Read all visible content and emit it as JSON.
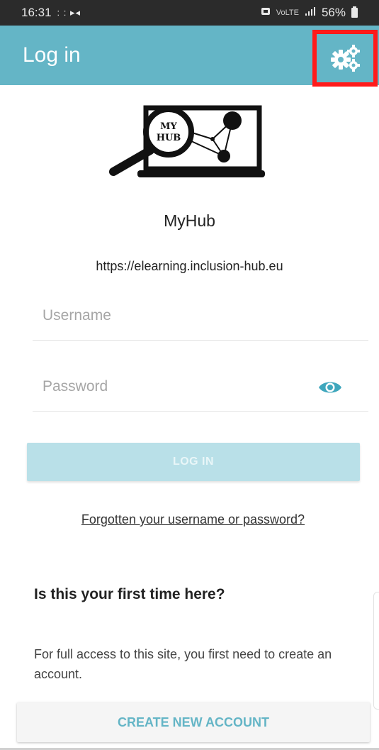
{
  "status_bar": {
    "time": "16:31",
    "notification_indicators": ": : ▸◂",
    "signal_text": "VoLTE",
    "battery": "56%"
  },
  "app_bar": {
    "title": "Log in",
    "settings_icon": "gears-icon"
  },
  "site": {
    "logo_text_line1": "MY",
    "logo_text_line2": "HUB",
    "name": "MyHub",
    "url": "https://elearning.inclusion-hub.eu"
  },
  "form": {
    "username_placeholder": "Username",
    "username_value": "",
    "password_placeholder": "Password",
    "password_value": "",
    "show_password_icon": "eye-icon",
    "login_label": "LOG IN",
    "forgot_link": "Forgotten your username or password?"
  },
  "signup": {
    "heading": "Is this your first time here?",
    "body": "For full access to this site, you first need to create an account.",
    "create_account_label": "CREATE NEW ACCOUNT"
  },
  "colors": {
    "accent": "#64b5c6",
    "login_button_disabled": "#b9e0e8",
    "highlight_box": "#ff1a1a"
  }
}
